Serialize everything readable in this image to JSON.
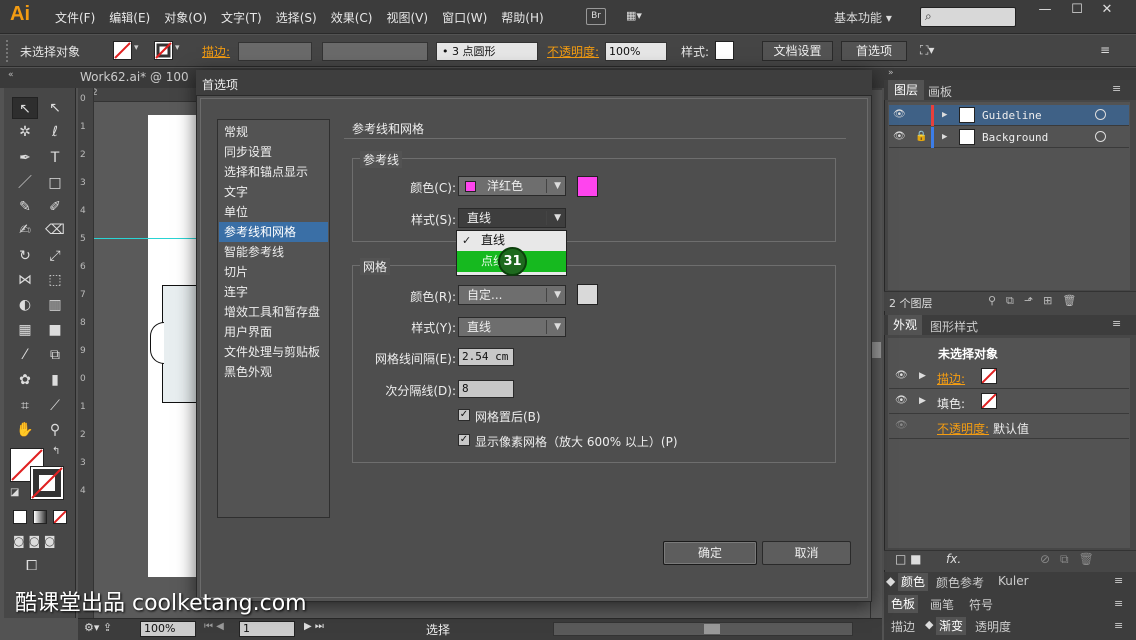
{
  "app": {
    "logo": "Ai",
    "menu": [
      "文件(F)",
      "编辑(E)",
      "对象(O)",
      "文字(T)",
      "选择(S)",
      "效果(C)",
      "视图(V)",
      "窗口(W)",
      "帮助(H)"
    ],
    "bridge": "Br",
    "workspace": "基本功能",
    "workspace_arrow": "▾"
  },
  "controlbar": {
    "no_selection": "未选择对象",
    "stroke_label": "描边:",
    "brush_value": "• 3 点圆形",
    "opacity_label": "不透明度:",
    "opacity_value": "100%",
    "style_label": "样式:",
    "doc_settings": "文档设置",
    "preferences": "首选项"
  },
  "document": {
    "tab_title": "Work62.ai* @ 100",
    "zoom": "100%",
    "page": "1",
    "status": "选择",
    "ruler_marks": [
      "2",
      "0",
      "1",
      "2",
      "3",
      "4",
      "5",
      "6",
      "7",
      "8",
      "9",
      "0",
      "1",
      "2",
      "3",
      "4"
    ]
  },
  "dialog": {
    "title": "首选项",
    "categories": [
      "常规",
      "同步设置",
      "选择和锚点显示",
      "文字",
      "单位",
      "参考线和网格",
      "智能参考线",
      "切片",
      "连字",
      "增效工具和暂存盘",
      "用户界面",
      "文件处理与剪贴板",
      "黑色外观"
    ],
    "selected_category_index": 5,
    "section_title": "参考线和网格",
    "guides": {
      "group": "参考线",
      "color_label": "颜色(C):",
      "color_value": "洋红色",
      "color_hex": "#ff44ee",
      "style_label": "样式(S):",
      "style_value": "直线",
      "popup_options": [
        "直线",
        "点线"
      ],
      "popup_checked": "✓"
    },
    "grid": {
      "group": "网格",
      "color_label": "颜色(R):",
      "color_value": "自定...",
      "color_hex": "#d9d9d9",
      "style_label": "样式(Y):",
      "style_value": "直线",
      "spacing_label": "网格线间隔(E):",
      "spacing_value": "2.54 cm",
      "subdiv_label": "次分隔线(D):",
      "subdiv_value": "8",
      "back_label": "网格置后(B)",
      "back_checked": "✓",
      "pixel_label": "显示像素网格（放大 600% 以上）(P)",
      "pixel_checked": "✓"
    },
    "ok": "确定",
    "cancel": "取消"
  },
  "cursor_step": "31",
  "layers_panel": {
    "tabs": [
      "图层",
      "画板"
    ],
    "layers": [
      {
        "name": "Guideline",
        "color": "#e8403c"
      },
      {
        "name": "Background",
        "color": "#3c7de8"
      }
    ],
    "count": "2 个图层"
  },
  "appearance_panel": {
    "tabs": [
      "外观",
      "图形样式"
    ],
    "header": "未选择对象",
    "rows": [
      {
        "label": "描边:"
      },
      {
        "label": "填色:"
      }
    ],
    "opacity_label": "不透明度:",
    "opacity_value": "默认值",
    "fx": "fx."
  },
  "color_panels": {
    "row1": [
      "颜色",
      "颜色参考",
      "Kuler"
    ],
    "row2": [
      "色板",
      "画笔",
      "符号"
    ],
    "row3": [
      "描边",
      "渐变",
      "透明度"
    ]
  },
  "watermark": "酷课堂出品 coolketang.com"
}
